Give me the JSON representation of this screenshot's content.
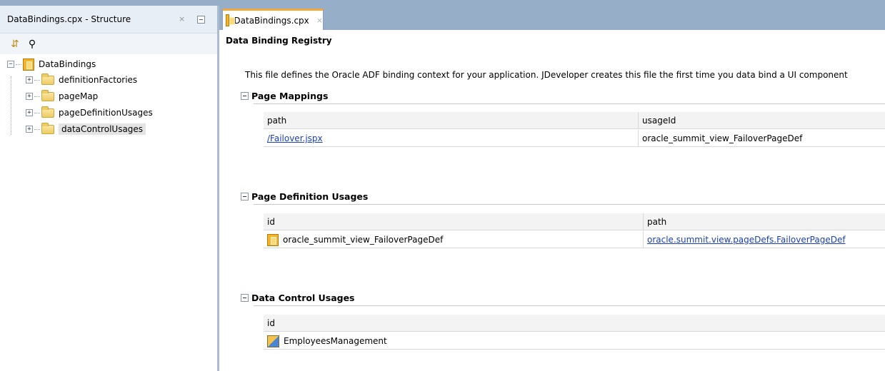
{
  "structure_panel": {
    "title": "DataBindings.cpx - Structure",
    "close_glyph": "×",
    "toolbar": {
      "icons": [
        "expand-tree-icon",
        "find-icon"
      ]
    },
    "tree": {
      "root": "DataBindings",
      "children": [
        "definitionFactories",
        "pageMap",
        "pageDefinitionUsages",
        "dataControlUsages"
      ],
      "selected": "dataControlUsages"
    }
  },
  "editor": {
    "tab_label": "DataBindings.cpx",
    "tab_close": "×",
    "heading": "Data Binding Registry",
    "description": "This file defines the Oracle ADF binding context for your application. JDeveloper creates this file the first time you data bind a UI component",
    "page_mappings": {
      "title": "Page Mappings",
      "columns": [
        "path",
        "usageId"
      ],
      "rows": [
        {
          "path": "/Failover.jspx",
          "usageId": "oracle_summit_view_FailoverPageDef"
        }
      ]
    },
    "page_definition_usages": {
      "title": "Page Definition Usages",
      "columns": [
        "id",
        "path"
      ],
      "rows": [
        {
          "id": "oracle_summit_view_FailoverPageDef",
          "path": "oracle.summit.view.pageDefs.FailoverPageDef"
        }
      ]
    },
    "data_control_usages": {
      "title": "Data Control Usages",
      "columns": [
        "id"
      ],
      "rows": [
        {
          "id": "EmployeesManagement"
        }
      ]
    }
  },
  "colors": {
    "chrome_blue": "#97aec9",
    "tab_accent": "#f2a93b",
    "link": "#1b3fb8"
  }
}
